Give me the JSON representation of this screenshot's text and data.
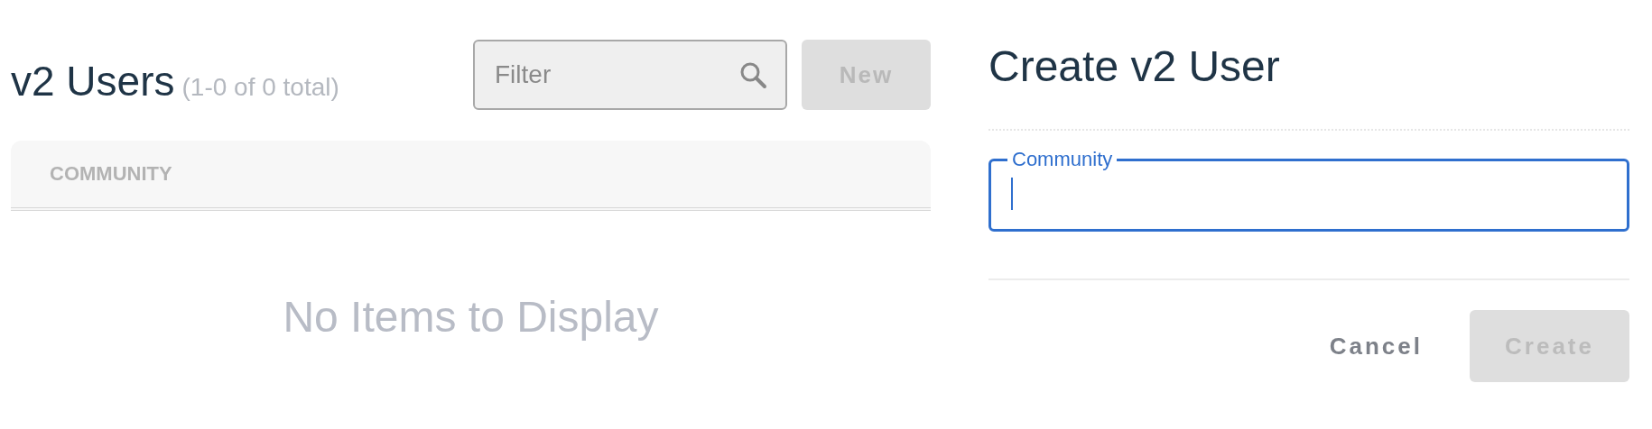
{
  "list": {
    "title": "v2 Users",
    "count": "(1-0 of 0 total)",
    "filter": {
      "placeholder": "Filter"
    },
    "new_button": {
      "label": "New",
      "disabled": true
    },
    "table": {
      "columns": [
        "COMMUNITY"
      ],
      "empty_message": "No Items to Display"
    }
  },
  "form": {
    "title": "Create v2 User",
    "fields": [
      {
        "label": "Community",
        "focused": true
      }
    ],
    "buttons": [
      {
        "label": "Cancel",
        "kind": "secondary",
        "disabled": false
      },
      {
        "label": "Create",
        "kind": "primary",
        "disabled": true
      }
    ]
  }
}
